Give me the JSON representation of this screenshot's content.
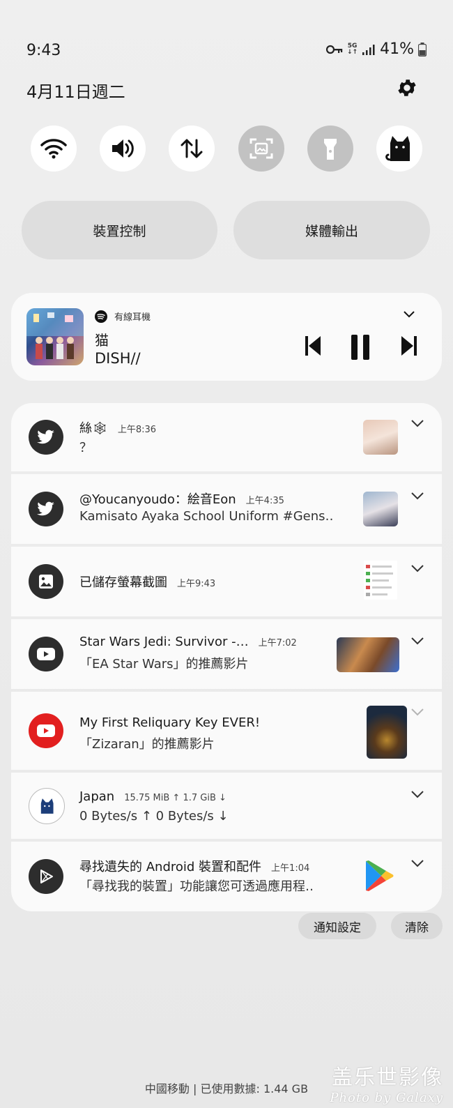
{
  "status": {
    "time": "9:43",
    "network": "5G",
    "battery": "41%"
  },
  "date": "4月11日週二",
  "tiles": [
    {
      "icon": "wifi-icon",
      "state": "on"
    },
    {
      "icon": "volume-icon",
      "state": "on"
    },
    {
      "icon": "data-transfer-icon",
      "state": "on"
    },
    {
      "icon": "screen-capture-icon",
      "state": "off"
    },
    {
      "icon": "flashlight-icon",
      "state": "off"
    },
    {
      "icon": "cat-vpn-icon",
      "state": "on"
    }
  ],
  "buttons": {
    "device_control": "裝置控制",
    "media_output": "媒體輸出"
  },
  "media": {
    "source": "有線耳機",
    "title": "猫",
    "artist": "DISH//"
  },
  "notifications": [
    {
      "app": "twitter",
      "title": "絲🕸",
      "time": "上午8:36",
      "text": "？"
    },
    {
      "app": "twitter",
      "title": "@Youcanyoudo：絵音Eon",
      "time": "上午4:35",
      "text": "Kamisato Ayaka School Uniform  #Gens‥"
    },
    {
      "app": "gallery",
      "title": "已儲存螢幕截圖",
      "time": "上午9:43",
      "text": ""
    },
    {
      "app": "youtube",
      "title": "Star Wars Jedi: Survivor -…",
      "time": "上午7:02",
      "text": "「EA Star Wars」的推薦影片"
    },
    {
      "app": "youtube",
      "title": "My First Reliquary Key EVER!",
      "time": "",
      "text": "「Zizaran」的推薦影片"
    },
    {
      "app": "vpn",
      "title": "Japan",
      "time": "15.75 MiB ↑ 1.7 GiB ↓",
      "text": "0 Bytes/s ↑  0 Bytes/s ↓"
    },
    {
      "app": "find-device",
      "title": "尋找遺失的 Android 裝置和配件",
      "time": "上午1:04",
      "text": "「尋找我的裝置」功能讓您可透過應用程‥"
    }
  ],
  "actions": {
    "notification_settings": "通知設定",
    "clear": "清除"
  },
  "footer": "中國移動 | 已使用數據: 1.44 GB",
  "watermark": {
    "line1": "盖乐世影像",
    "line2": "Photo by Galaxy"
  }
}
